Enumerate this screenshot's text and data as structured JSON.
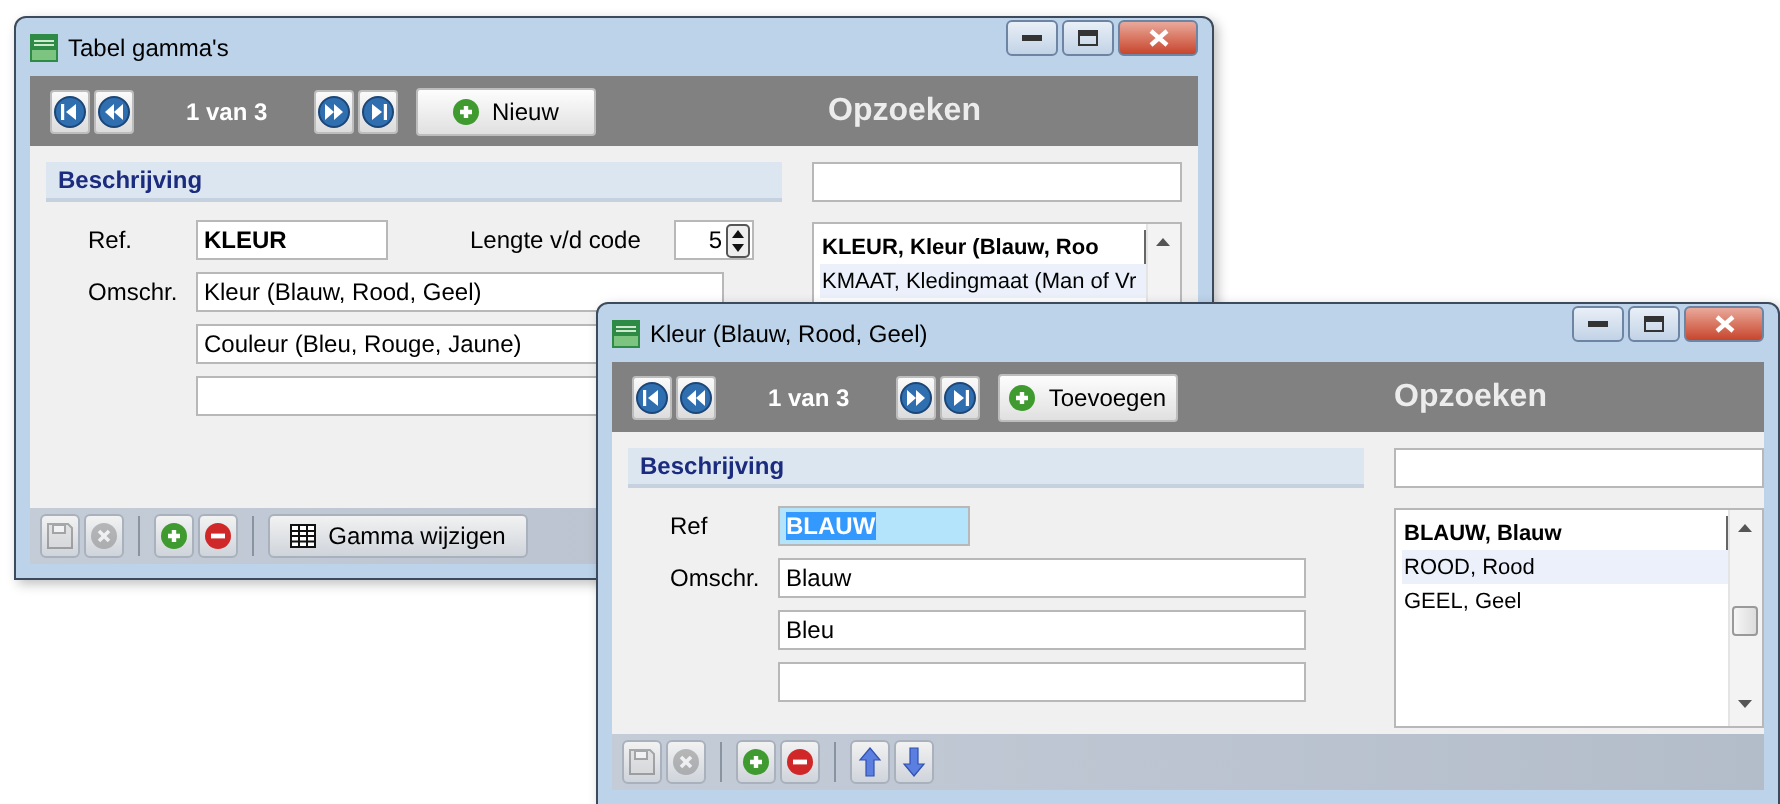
{
  "windows": [
    {
      "title": "Tabel gamma's",
      "position": "1 van 3",
      "add_button": "Nieuw",
      "lookup_title": "Opzoeken",
      "section": "Beschrijving",
      "ref": {
        "label": "Ref.",
        "value": "KLEUR",
        "focused": false
      },
      "code_length": {
        "label": "Lengte v/d code",
        "value": "5"
      },
      "description_label": "Omschr.",
      "descriptions": [
        {
          "kind": "text",
          "value": "Kleur (Blauw, Rood, Geel)"
        },
        {
          "kind": "text",
          "value": "Couleur (Bleu, Rouge, Jaune)"
        },
        {
          "kind": "blank"
        }
      ],
      "lookup_items": [
        {
          "text": "KLEUR, Kleur (Blauw, Roo",
          "selected": true,
          "highlighted": false
        },
        {
          "text": "KMAAT, Kledingmaat (Man of Vr",
          "selected": false,
          "highlighted": true
        }
      ],
      "tools": [
        {
          "kind": "save",
          "disabled": true
        },
        {
          "kind": "cancel",
          "disabled": true
        },
        {
          "kind": "separator"
        },
        {
          "kind": "add",
          "disabled": false
        },
        {
          "kind": "delete",
          "disabled": false
        },
        {
          "kind": "separator"
        },
        {
          "kind": "grid",
          "label": "Gamma wijzigen"
        }
      ]
    },
    {
      "title": "Kleur (Blauw, Rood, Geel)",
      "position": "1 van 3",
      "add_button": "Toevoegen",
      "lookup_title": "Opzoeken",
      "section": "Beschrijving",
      "ref": {
        "label": "Ref",
        "value": "BLAUW",
        "focused": true
      },
      "description_label": "Omschr.",
      "descriptions": [
        {
          "kind": "text",
          "value": "Blauw"
        },
        {
          "kind": "text",
          "value": "Bleu"
        },
        {
          "kind": "blank"
        }
      ],
      "lookup_items": [
        {
          "text": "BLAUW, Blauw",
          "selected": true,
          "highlighted": false
        },
        {
          "text": "ROOD, Rood",
          "selected": false,
          "highlighted": true
        },
        {
          "text": "GEEL, Geel",
          "selected": false,
          "highlighted": false
        }
      ],
      "tools": [
        {
          "kind": "save",
          "disabled": true
        },
        {
          "kind": "cancel",
          "disabled": true
        },
        {
          "kind": "separator"
        },
        {
          "kind": "add",
          "disabled": false
        },
        {
          "kind": "delete",
          "disabled": false
        },
        {
          "kind": "separator"
        },
        {
          "kind": "up",
          "disabled": false
        },
        {
          "kind": "down",
          "disabled": false
        }
      ]
    }
  ]
}
